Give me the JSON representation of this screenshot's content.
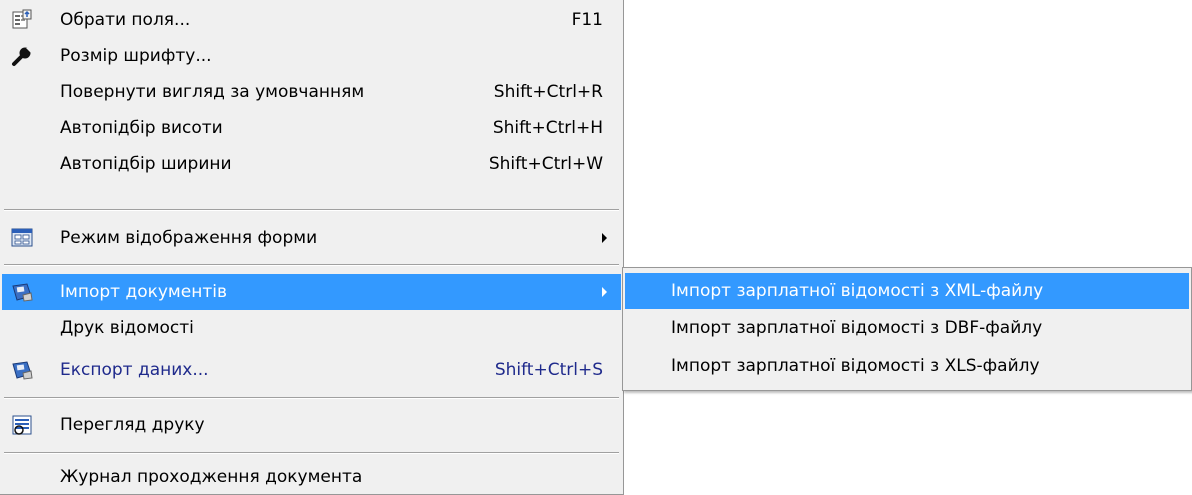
{
  "menu": {
    "items": [
      {
        "label": "Обрати поля...",
        "shortcut": "F11",
        "icon": "select-fields-icon"
      },
      {
        "label": "Розмір шрифту...",
        "shortcut": "",
        "icon": "wrench-icon"
      },
      {
        "label": "Повернути вигляд за умовчанням",
        "shortcut": "Shift+Ctrl+R"
      },
      {
        "label": "Автопідбір висоти",
        "shortcut": "Shift+Ctrl+H"
      },
      {
        "label": "Автопідбір ширини",
        "shortcut": "Shift+Ctrl+W"
      },
      {
        "label": "Режим відображення форми",
        "icon": "form-view-icon",
        "has_submenu": true
      },
      {
        "label": "Імпорт документів",
        "icon": "disk-import-icon",
        "has_submenu": true,
        "selected": true
      },
      {
        "label": "Друк відомості"
      },
      {
        "label": "Експорт даних...",
        "shortcut": "Shift+Ctrl+S",
        "icon": "disk-export-icon"
      },
      {
        "label": "Перегляд друку",
        "icon": "print-preview-icon"
      },
      {
        "label": "Журнал проходження документа"
      }
    ]
  },
  "submenu": {
    "items": [
      {
        "label": "Імпорт зарплатної відомості з XML-файлу",
        "selected": true
      },
      {
        "label": "Імпорт зарплатної відомості з DBF-файлу"
      },
      {
        "label": "Імпорт зарплатної відомості з XLS-файлу"
      }
    ]
  },
  "colors": {
    "highlight": "#3399ff",
    "menu_bg": "#f0f0f0",
    "border": "#979797"
  }
}
